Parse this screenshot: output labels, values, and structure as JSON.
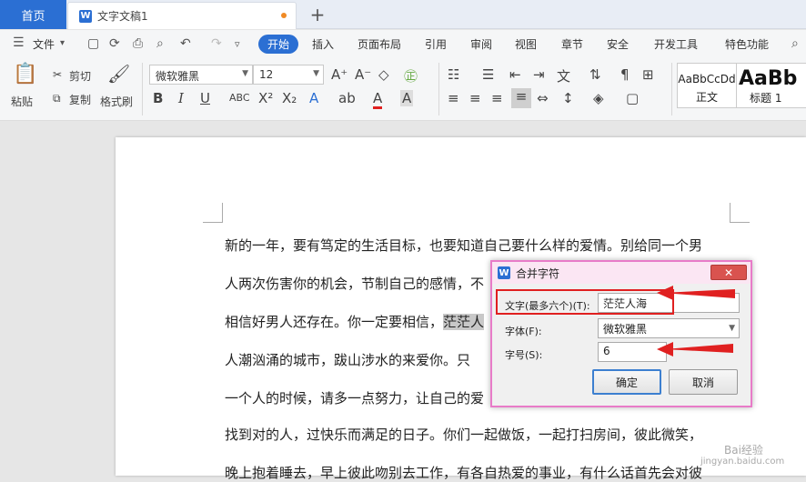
{
  "tabs": {
    "home": "首页",
    "doc_name": "文字文稿1",
    "new_tab": "+"
  },
  "menu": {
    "file": "文件",
    "items": [
      "开始",
      "插入",
      "页面布局",
      "引用",
      "审阅",
      "视图",
      "章节",
      "安全",
      "开发工具",
      "特色功能"
    ]
  },
  "ribbon": {
    "paste": "粘贴",
    "cut": "剪切",
    "copy": "复制",
    "format_painter": "格式刷",
    "font_name": "微软雅黑",
    "font_size": "12",
    "style_normal_preview": "AaBbCcDd",
    "style_normal_label": "正文",
    "style_h1_preview": "AaBb",
    "style_h1_label": "标题 1"
  },
  "document": {
    "lines": [
      "新的一年，要有笃定的生活目标，也要知道自己要什么样的爱情。别给同一个男",
      "人两次伤害你的机会，节制自己的感情，不",
      "相信好男人还存在。你一定要相信，",
      "人潮汹涌的城市，跋山涉水的来爱你。只",
      "一个人的时候，请多一点努力，让自己的爱",
      "找到对的人，过快乐而满足的日子。你们一起做饭，一起打扫房间，彼此微笑，",
      "晚上抱着睡去，早上彼此吻别去工作，有各自热爱的事业，有什么话首先会对彼"
    ],
    "highlight": "茫茫人"
  },
  "dialog": {
    "title": "合并字符",
    "text_label": "文字(最多六个)(T):",
    "text_value": "茫茫人海",
    "font_label": "字体(F):",
    "font_value": "微软雅黑",
    "size_label": "字号(S):",
    "size_value": "6",
    "ok": "确定",
    "cancel": "取消"
  },
  "watermark": {
    "line1": "Bai经验",
    "line2": "jingyan.baidu.com"
  },
  "colors": {
    "accent": "#2b6fd3",
    "annotation": "#e02020",
    "dialog_border": "#e87bc8"
  }
}
